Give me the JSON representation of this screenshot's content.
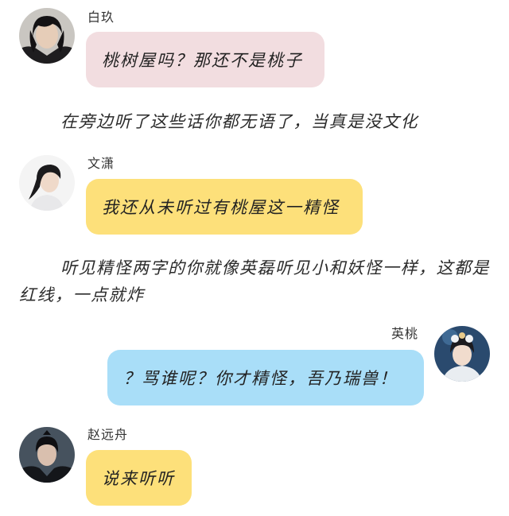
{
  "colors": {
    "bubble_pink": "#f2dde0",
    "bubble_yellow": "#fde07a",
    "bubble_blue": "#a9def8"
  },
  "messages": [
    {
      "speaker": "白玖",
      "text": "桃树屋吗？那还不是桃子",
      "bubble_color": "pink",
      "side": "left",
      "avatar_icon": "male-avatar-icon"
    },
    {
      "speaker": "文潇",
      "text": "我还从未听过有桃屋这一精怪",
      "bubble_color": "yellow",
      "side": "left",
      "avatar_icon": "female-avatar-icon"
    },
    {
      "speaker": "英桃",
      "text": "？骂谁呢？你才精怪，吾乃瑞兽！",
      "bubble_color": "blue",
      "side": "right",
      "avatar_icon": "female-avatar-icon"
    },
    {
      "speaker": "赵远舟",
      "text": "说来听听",
      "bubble_color": "yellow",
      "side": "left",
      "avatar_icon": "male-avatar-icon"
    }
  ],
  "narrations": [
    "在旁边听了这些话你都无语了，当真是没文化",
    "听见精怪两字的你就像英磊听见小和妖怪一样，这都是红线，一点就炸"
  ]
}
